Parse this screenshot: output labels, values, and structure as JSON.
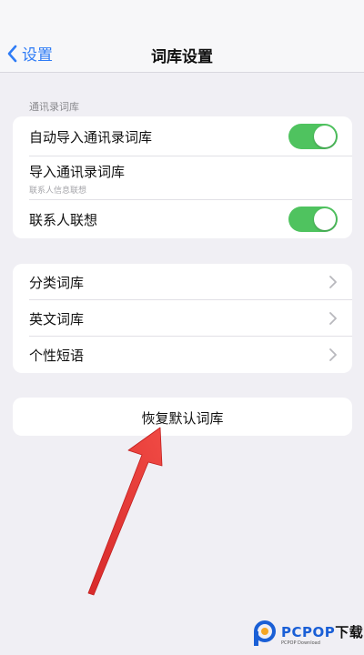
{
  "nav": {
    "back_label": "设置",
    "title": "词库设置"
  },
  "section1": {
    "header": "通讯录词库",
    "rows": [
      {
        "label": "自动导入通讯录词库",
        "toggle_on": true
      },
      {
        "label": "导入通讯录词库",
        "sublabel": "联系人信息联想"
      },
      {
        "label": "联系人联想",
        "toggle_on": true
      }
    ]
  },
  "section2": {
    "rows": [
      {
        "label": "分类词库"
      },
      {
        "label": "英文词库"
      },
      {
        "label": "个性短语"
      }
    ]
  },
  "reset": {
    "label": "恢复默认词库"
  },
  "watermark": {
    "brand": "PCPOP",
    "suffix": "下载",
    "sub": "PCPOP Download"
  },
  "colors": {
    "accent": "#2f7cf6",
    "toggle_on": "#4fc35f",
    "arrow": "#e5312f",
    "background": "#f0eff4"
  },
  "icons": {
    "back": "chevron-left-icon",
    "row_disclosure": "chevron-right-icon",
    "annotation": "red-arrow"
  }
}
